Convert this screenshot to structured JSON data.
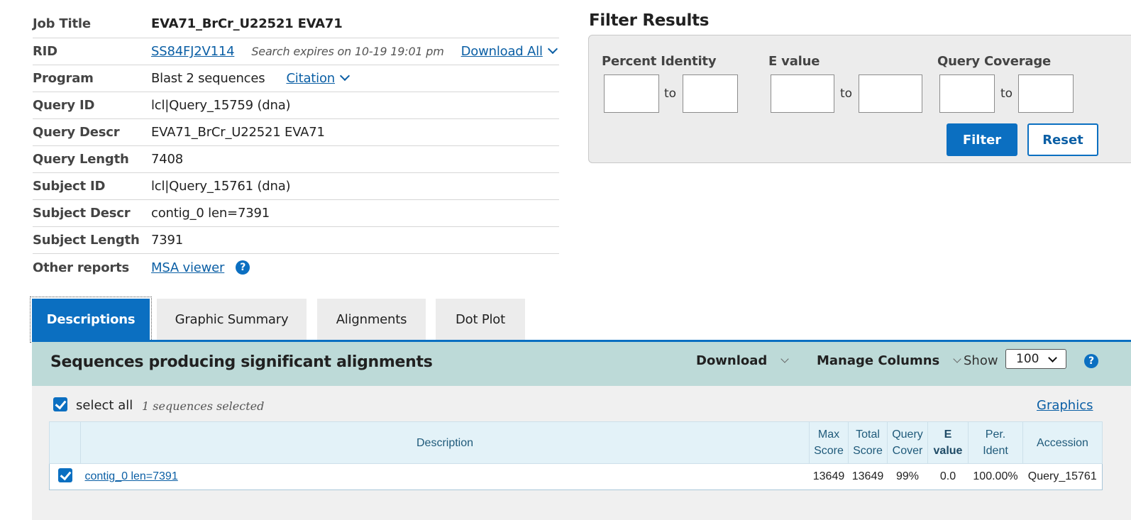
{
  "job": {
    "rows": [
      {
        "label": "Job Title",
        "value": "EVA71_BrCr_U22521 EVA71"
      },
      {
        "label": "RID",
        "value": "SS84FJ2V114",
        "expires": "Search expires on 10-19 19:01 pm",
        "download_all": "Download All"
      },
      {
        "label": "Program",
        "value": "Blast 2 sequences",
        "citation": "Citation"
      },
      {
        "label": "Query ID",
        "value": "lcl|Query_15759 (dna)"
      },
      {
        "label": "Query Descr",
        "value": "EVA71_BrCr_U22521 EVA71"
      },
      {
        "label": "Query Length",
        "value": "7408"
      },
      {
        "label": "Subject ID",
        "value": "lcl|Query_15761 (dna)"
      },
      {
        "label": "Subject Descr",
        "value": "contig_0 len=7391"
      },
      {
        "label": "Subject Length",
        "value": "7391"
      },
      {
        "label": "Other reports",
        "value": "MSA viewer",
        "help": "?"
      }
    ]
  },
  "filter": {
    "title": "Filter Results",
    "percent_identity": "Percent Identity",
    "e_value": "E value",
    "query_coverage": "Query Coverage",
    "to": "to",
    "filter_button": "Filter",
    "reset_button": "Reset"
  },
  "tabs": [
    "Descriptions",
    "Graphic Summary",
    "Alignments",
    "Dot Plot"
  ],
  "results": {
    "title": "Sequences producing significant alignments",
    "download": "Download",
    "manage_columns": "Manage Columns",
    "show": "Show",
    "show_value": "100",
    "help": "?",
    "select_all": "select all",
    "selected_count": "1 sequences selected",
    "graphics": "Graphics",
    "columns": {
      "description": "Description",
      "max_score": [
        "Max",
        "Score"
      ],
      "total_score": [
        "Total",
        "Score"
      ],
      "query_cover": [
        "Query",
        "Cover"
      ],
      "e_value": [
        "E",
        "value"
      ],
      "per_ident": [
        "Per.",
        "Ident"
      ],
      "accession": "Accession"
    },
    "rows": [
      {
        "description": "contig_0 len=7391",
        "max_score": "13649",
        "total_score": "13649",
        "query_cover": "99%",
        "e_value": "0.0",
        "per_ident": "100.00%",
        "accession": "Query_15761"
      }
    ]
  },
  "colors": {
    "accent": "#0b6fc1",
    "header_bg": "#bddad8",
    "link": "#0b5fa5"
  }
}
